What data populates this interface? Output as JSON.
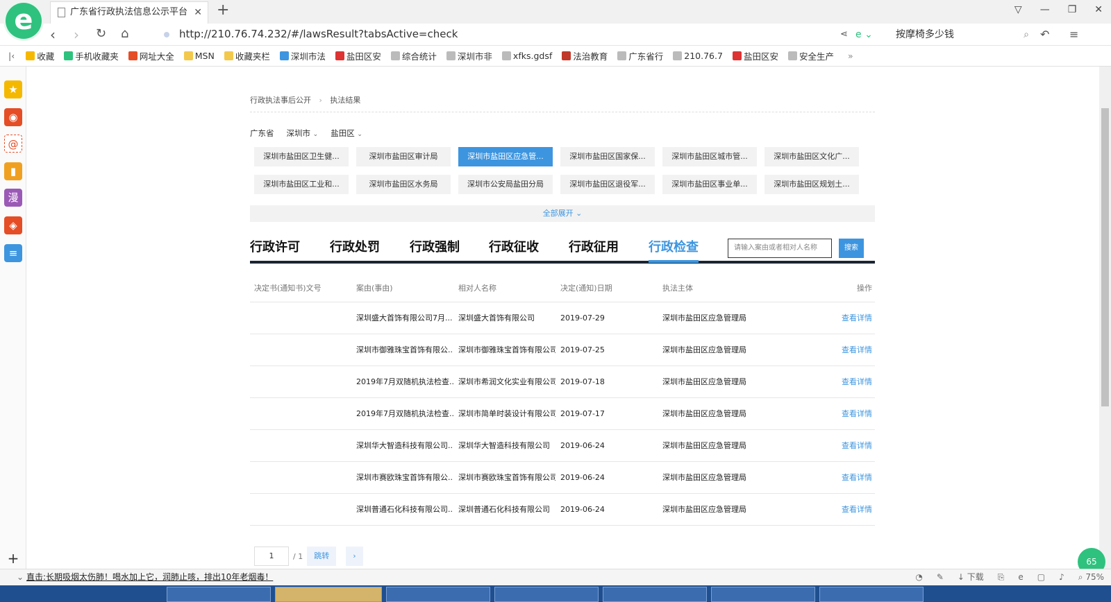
{
  "browser": {
    "tab_title": "广东省行政执法信息公示平台",
    "url": "http://210.76.74.232/#/lawsResult?tabsActive=check",
    "search_text": "按摩椅多少钱",
    "logo": "e"
  },
  "bookmarks": [
    {
      "label": "收藏",
      "color": "#f5b800"
    },
    {
      "label": "手机收藏夹",
      "color": "#2ec27e"
    },
    {
      "label": "网址大全",
      "color": "#e54d26"
    },
    {
      "label": "MSN",
      "color": "#f2c94c"
    },
    {
      "label": "收藏夹栏",
      "color": "#f2c94c"
    },
    {
      "label": "深圳市法",
      "color": "#3d95df"
    },
    {
      "label": "盐田区安",
      "color": "#d33"
    },
    {
      "label": "综合统计",
      "color": "#bbb"
    },
    {
      "label": "深圳市非",
      "color": "#bbb"
    },
    {
      "label": "xfks.gdsf",
      "color": "#bbb"
    },
    {
      "label": "法治教育",
      "color": "#c0392b"
    },
    {
      "label": "广东省行",
      "color": "#bbb"
    },
    {
      "label": "210.76.7",
      "color": "#bbb"
    },
    {
      "label": "盐田区安",
      "color": "#d33"
    },
    {
      "label": "安全生产",
      "color": "#bbb"
    }
  ],
  "breadcrumb": {
    "level1": "行政执法事后公开",
    "separator": "›",
    "level2": "执法结果"
  },
  "region": {
    "province": "广东省",
    "city": "深圳市",
    "district": "盐田区"
  },
  "orgs": [
    "深圳市盐田区卫生健...",
    "深圳市盐田区审计局",
    "深圳市盐田区应急管...",
    "深圳市盐田区国家保...",
    "深圳市盐田区城市管...",
    "深圳市盐田区文化广...",
    "深圳市盐田区工业和...",
    "深圳市盐田区水务局",
    "深圳市公安局盐田分局",
    "深圳市盐田区退役军...",
    "深圳市盐田区事业单...",
    "深圳市盐田区规划土..."
  ],
  "expand_label": "全部展开 ⌄",
  "tabs": [
    "行政许可",
    "行政处罚",
    "行政强制",
    "行政征收",
    "行政征用",
    "行政检查"
  ],
  "search": {
    "placeholder": "请输入案由或者相对人名称",
    "button": "搜索"
  },
  "table": {
    "headers": [
      "决定书(通知书)文号",
      "案由(事由)",
      "相对人名称",
      "决定(通知)日期",
      "执法主体",
      "操作"
    ],
    "rows": [
      {
        "doc": "",
        "reason": "深圳盛大首饰有限公司7月...",
        "party": "深圳盛大首饰有限公司",
        "date": "2019-07-29",
        "agency": "深圳市盐田区应急管理局",
        "action": "查看详情"
      },
      {
        "doc": "",
        "reason": "深圳市御雅珠宝首饰有限公...",
        "party": "深圳市御雅珠宝首饰有限公司",
        "date": "2019-07-25",
        "agency": "深圳市盐田区应急管理局",
        "action": "查看详情"
      },
      {
        "doc": "",
        "reason": "2019年7月双随机执法检查...",
        "party": "深圳市希润文化实业有限公司",
        "date": "2019-07-18",
        "agency": "深圳市盐田区应急管理局",
        "action": "查看详情"
      },
      {
        "doc": "",
        "reason": "2019年7月双随机执法检查...",
        "party": "深圳市简单时装设计有限公司",
        "date": "2019-07-17",
        "agency": "深圳市盐田区应急管理局",
        "action": "查看详情"
      },
      {
        "doc": "",
        "reason": "深圳华大智造科技有限公司...",
        "party": "深圳华大智造科技有限公司",
        "date": "2019-06-24",
        "agency": "深圳市盐田区应急管理局",
        "action": "查看详情"
      },
      {
        "doc": "",
        "reason": "深圳市赛欧珠宝首饰有限公...",
        "party": "深圳市赛欧珠宝首饰有限公司",
        "date": "2019-06-24",
        "agency": "深圳市盐田区应急管理局",
        "action": "查看详情"
      },
      {
        "doc": "",
        "reason": "深圳普通石化科技有限公司...",
        "party": "深圳普通石化科技有限公司",
        "date": "2019-06-24",
        "agency": "深圳市盐田区应急管理局",
        "action": "查看详情"
      }
    ]
  },
  "pager": {
    "current": "1",
    "total": "/ 1",
    "jump": "跳转",
    "next": "›"
  },
  "statusbar": {
    "news": "直击:长期吸烟太伤肺！喝水加上它，润肺止咳，排出10年老烟毒！",
    "download": "下载",
    "zoom": "75%"
  },
  "badge": "65"
}
